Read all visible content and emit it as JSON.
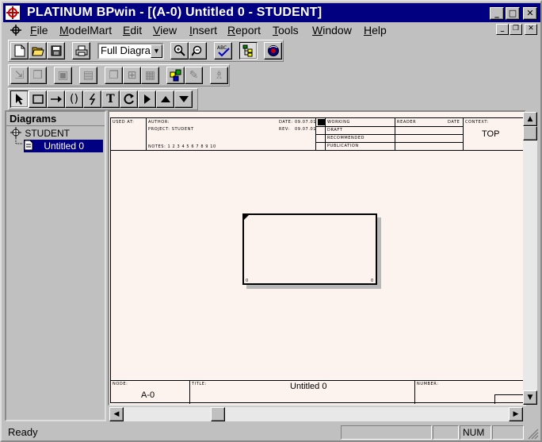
{
  "window": {
    "title": "PLATINUM BPwin - [(A-0) Untitled 0 - STUDENT]",
    "controls": {
      "minimize": "_",
      "maximize": "□",
      "close": "✕"
    }
  },
  "menu": [
    {
      "label": "File",
      "u": "F",
      "rest": "ile"
    },
    {
      "label": "ModelMart",
      "u": "M",
      "rest": "odelMart"
    },
    {
      "label": "Edit",
      "u": "E",
      "rest": "dit"
    },
    {
      "label": "View",
      "u": "V",
      "rest": "iew"
    },
    {
      "label": "Insert",
      "u": "I",
      "rest": "nsert"
    },
    {
      "label": "Report",
      "u": "R",
      "rest": "eport"
    },
    {
      "label": "Tools",
      "u": "T",
      "rest": "ools"
    },
    {
      "label": "Window",
      "u": "W",
      "rest": "indow"
    },
    {
      "label": "Help",
      "u": "H",
      "rest": "elp"
    }
  ],
  "toolbar": {
    "zoom_select_value": "Full Diagram",
    "zoom_select_visible": "Full Diagra",
    "icons": [
      "new-icon",
      "open-icon",
      "save-icon",
      "print-icon",
      "zoom-in-icon",
      "zoom-out-icon",
      "spell-check-icon",
      "model-explorer-icon",
      "modelmart-icon"
    ]
  },
  "palette": {
    "tools": [
      "pointer-tool-icon",
      "activity-box-tool-icon",
      "arrow-tool-icon",
      "squiggle-tool-icon",
      "split-merge-tool-icon",
      "text-tool-icon",
      "off-page-reference-tool-icon",
      "go-to-child-icon",
      "go-to-parent-icon",
      "go-to-sibling-icon"
    ]
  },
  "diagrams_panel": {
    "header": "Diagrams",
    "tree": [
      {
        "label": "STUDENT",
        "level": 0,
        "selected": false
      },
      {
        "label": "Untitled 0",
        "level": 1,
        "selected": true
      }
    ]
  },
  "form": {
    "used_at": "USED AT:",
    "author": "AUTHOR:",
    "project": "PROJECT: STUDENT",
    "date_label": "DATE:",
    "date_value": "09.07.01",
    "rev_label": "REV:",
    "rev_value": "09.07.01",
    "notes": "NOTES: 1 2 3 4 5 6 7 8 9 10",
    "status": [
      "WORKING",
      "DRAFT",
      "RECOMMENDED",
      "PUBLICATION"
    ],
    "reader": "READER",
    "date2": "DATE",
    "context_label": "CONTEXT:",
    "context_value": "TOP",
    "node_label": "NODE:",
    "node_value": "A-0",
    "title_label": "TITLE:",
    "title_value": "Untitled 0",
    "number_label": "NUMBER:"
  },
  "activity_box": {
    "node_number": "0",
    "cost": "0"
  },
  "statusbar": {
    "text": "Ready",
    "num": "NUM"
  }
}
